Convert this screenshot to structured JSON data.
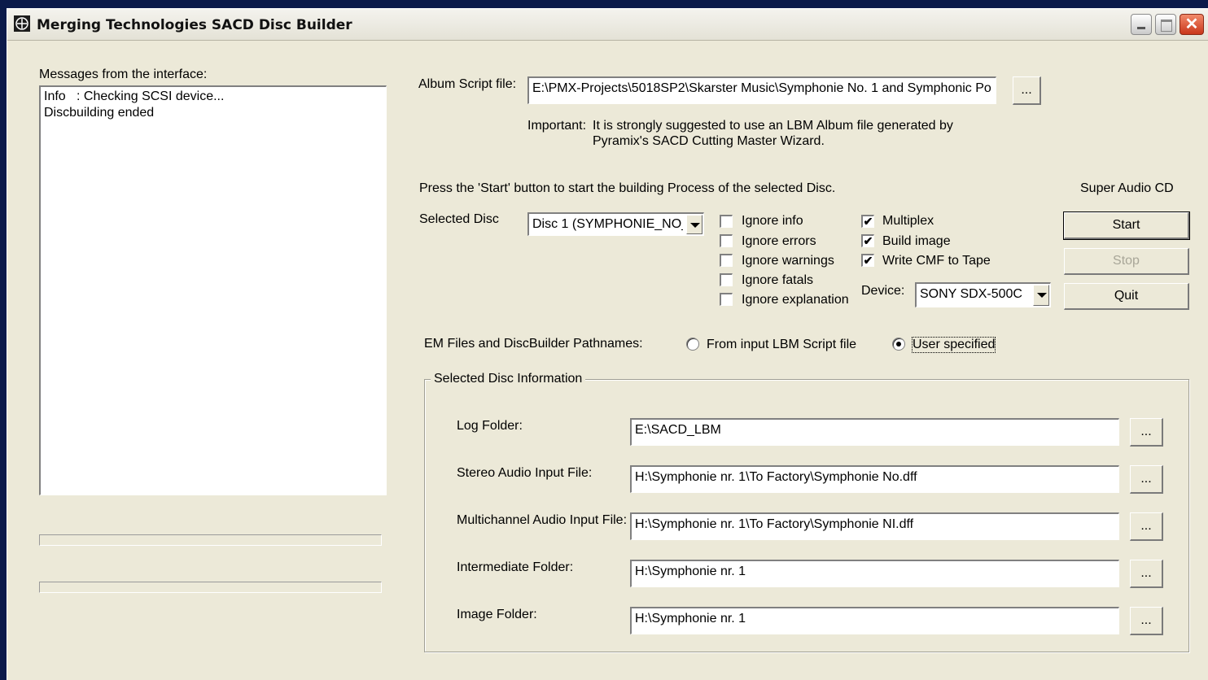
{
  "window": {
    "title": "Merging Technologies SACD Disc Builder",
    "close_glyph": "✕"
  },
  "messages": {
    "label": "Messages from the interface:",
    "lines": [
      "Info   : Checking SCSI device...",
      "Discbuilding ended"
    ]
  },
  "album_script": {
    "label": "Album Script file:",
    "value": "E:\\PMX-Projects\\5018SP2\\Skarster Music\\Symphonie No. 1 and Symphonic Po",
    "browse_label": "...",
    "important_label": "Important:",
    "important_line1": "It is strongly suggested to use an LBM Album file generated by",
    "important_line2": "Pyramix's SACD Cutting Master Wizard."
  },
  "instructions": "Press the 'Start' button to start the building Process of the selected Disc.",
  "product_label": "Super Audio CD",
  "selected_disc": {
    "label": "Selected Disc",
    "value": "Disc 1 (SYMPHONIE_NO_"
  },
  "options_left": [
    {
      "label": "Ignore info",
      "checked": false
    },
    {
      "label": "Ignore errors",
      "checked": false
    },
    {
      "label": "Ignore warnings",
      "checked": false
    },
    {
      "label": "Ignore fatals",
      "checked": false
    },
    {
      "label": "Ignore explanation",
      "checked": false
    }
  ],
  "options_right": [
    {
      "label": "Multiplex",
      "checked": true
    },
    {
      "label": "Build image",
      "checked": true
    },
    {
      "label": "Write CMF to Tape",
      "checked": true
    }
  ],
  "check_glyph": "✔",
  "device": {
    "label": "Device:",
    "value": "SONY SDX-500C"
  },
  "buttons": {
    "start": "Start",
    "stop": "Stop",
    "quit": "Quit"
  },
  "pathnames": {
    "label": "EM Files and DiscBuilder Pathnames:",
    "option_input": "From input LBM Script file",
    "option_user": "User specified",
    "selected": "User specified"
  },
  "disc_info": {
    "title": "Selected Disc Information",
    "browse_label": "...",
    "rows": [
      {
        "label": "Log Folder:",
        "value": "E:\\SACD_LBM"
      },
      {
        "label": "Stereo Audio Input File:",
        "value": "H:\\Symphonie nr. 1\\To Factory\\Symphonie No.dff"
      },
      {
        "label": "Multichannel Audio Input File:",
        "value": "H:\\Symphonie nr. 1\\To Factory\\Symphonie NI.dff"
      },
      {
        "label": "Intermediate Folder:",
        "value": "H:\\Symphonie nr. 1"
      },
      {
        "label": "Image Folder:",
        "value": "H:\\Symphonie nr. 1"
      }
    ]
  }
}
